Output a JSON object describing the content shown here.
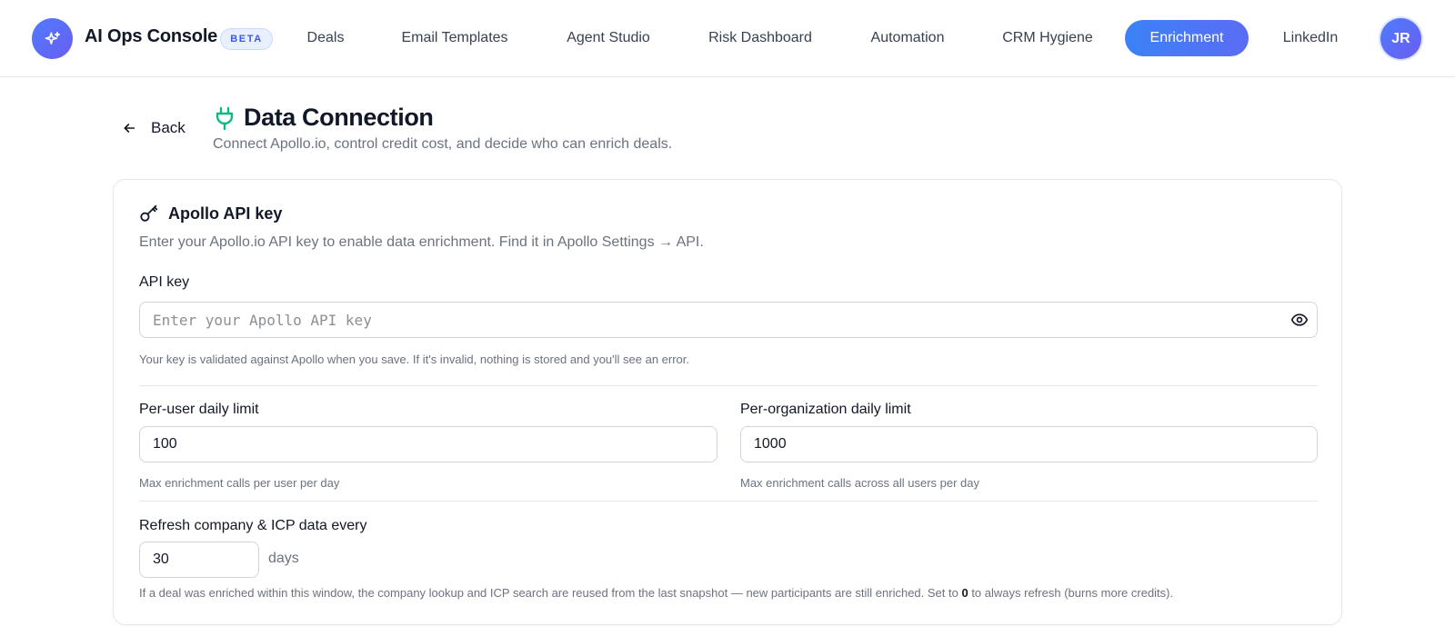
{
  "app": {
    "title": "AI Ops Console",
    "badge": "BETA",
    "accent": "#3b82f6"
  },
  "nav": {
    "items": [
      {
        "label": "Deals",
        "active": false
      },
      {
        "label": "Email Templates",
        "active": false
      },
      {
        "label": "Agent Studio",
        "active": false
      },
      {
        "label": "Risk Dashboard",
        "active": false
      },
      {
        "label": "Automation",
        "active": false
      },
      {
        "label": "CRM Hygiene",
        "active": false
      },
      {
        "label": "Enrichment",
        "active": true
      },
      {
        "label": "LinkedIn",
        "active": false
      }
    ],
    "avatar_initials": "JR"
  },
  "header": {
    "back_label": "Back",
    "title": "Data Connection",
    "subtitle": "Connect Apollo.io, control credit cost, and decide who can enrich deals.",
    "icon": "plug-icon",
    "icon_color": "#10b981"
  },
  "card": {
    "icon": "key-icon",
    "title": "Apollo API key",
    "description": "Enter your Apollo.io API key to enable data enrichment. Find it in Apollo Settings → API.",
    "api_key": {
      "label": "API key",
      "value": "",
      "placeholder": "Enter your Apollo API key",
      "hint": "Your key is validated against Apollo when you save. If it's invalid, nothing is stored and you'll see an error."
    },
    "per_user": {
      "label": "Per-user daily limit",
      "value": "100",
      "hint": "Max enrichment calls per user per day"
    },
    "per_org": {
      "label": "Per-organization daily limit",
      "value": "1000",
      "hint": "Max enrichment calls across all users per day"
    },
    "refresh": {
      "label": "Refresh company & ICP data every",
      "value": "30",
      "unit": "days",
      "hint_before": "If a deal was enriched within this window, the company lookup and ICP search are reused from the last snapshot — new participants are still enriched. Set to ",
      "hint_bold": "0",
      "hint_after": " to always refresh (burns more credits)."
    }
  }
}
